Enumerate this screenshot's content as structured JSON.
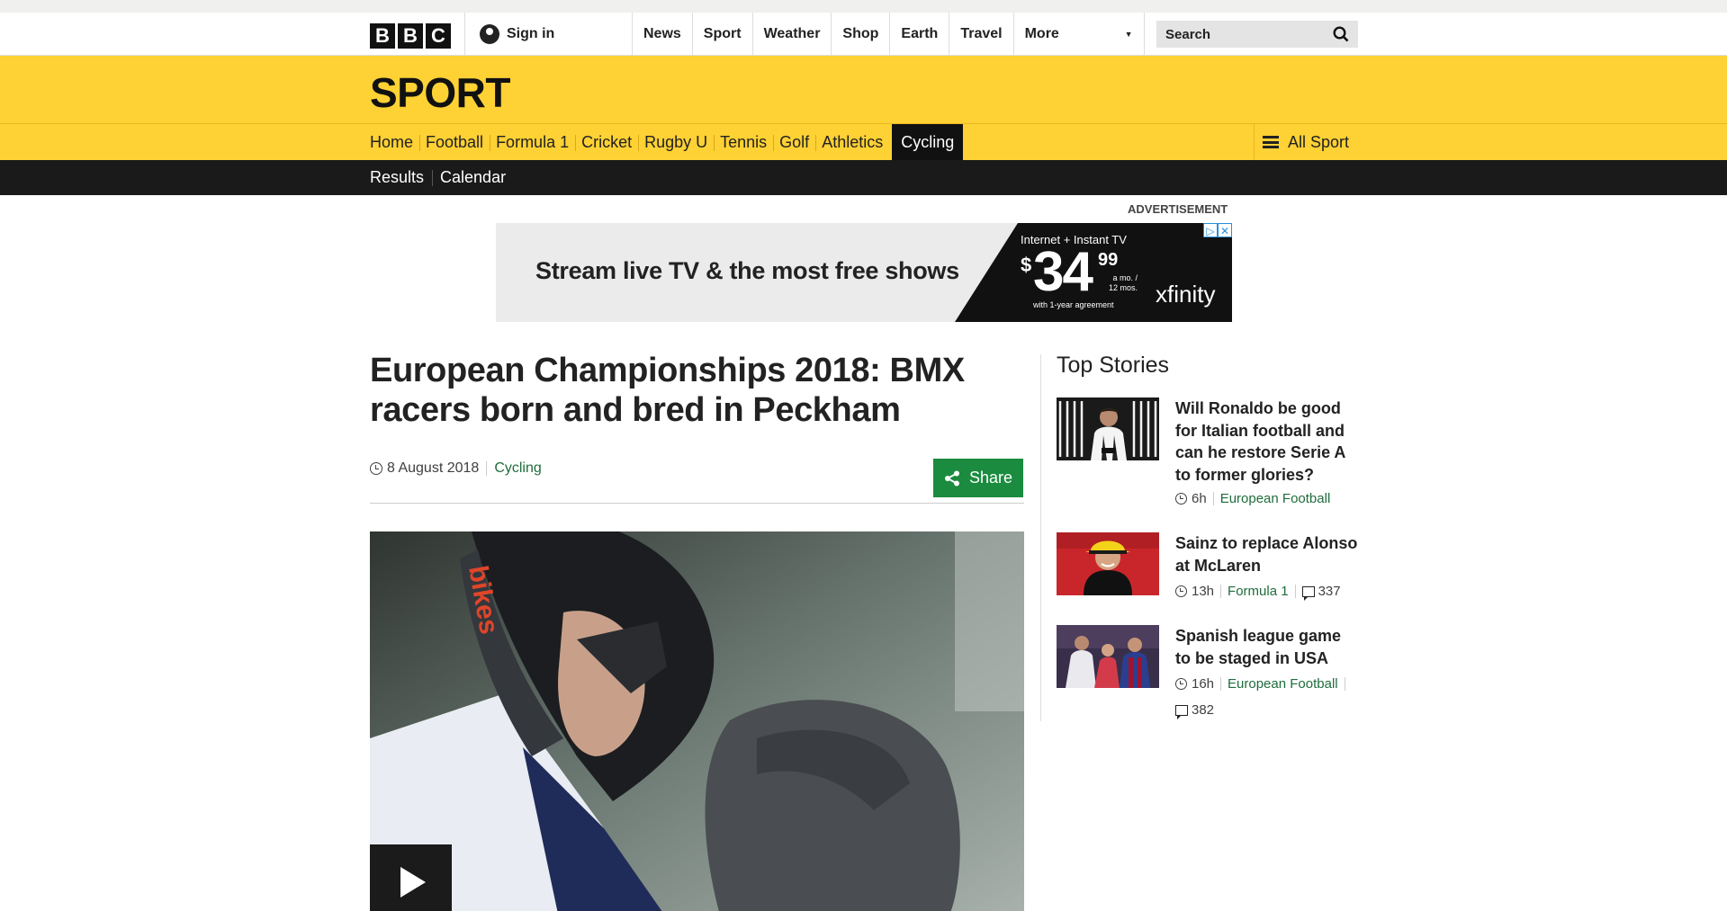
{
  "bbc": {
    "logo_letters": [
      "B",
      "B",
      "C"
    ],
    "signin_label": "Sign in",
    "nav": [
      "News",
      "Sport",
      "Weather",
      "Shop",
      "Earth",
      "Travel"
    ],
    "more_label": "More",
    "search_placeholder": "Search"
  },
  "sport": {
    "title": "SPORT",
    "nav": [
      "Home",
      "Football",
      "Formula 1",
      "Cricket",
      "Rugby U",
      "Tennis",
      "Golf",
      "Athletics",
      "Cycling"
    ],
    "active": "Cycling",
    "all_sport_label": "All Sport",
    "subnav": [
      "Results",
      "Calendar"
    ]
  },
  "ad": {
    "label": "ADVERTISEMENT",
    "tagline": "Stream live TV & the most free shows",
    "offer_line": "Internet + Instant TV",
    "dollar": "$",
    "price": "34",
    "cents": "99",
    "period": "a mo. / 12 mos.",
    "agreement": "with 1-year agreement",
    "brand": "xfinity"
  },
  "article": {
    "headline": "European Championships 2018: BMX racers born and bred in Peckham",
    "date": "8 August 2018",
    "topic": "Cycling",
    "share_label": "Share"
  },
  "top_stories": {
    "heading": "Top Stories",
    "items": [
      {
        "title": "Will Ronaldo be good for Italian football and can he restore Serie A to former glories?",
        "time": "6h",
        "topic": "European Football",
        "comments": ""
      },
      {
        "title": "Sainz to replace Alonso at McLaren",
        "time": "13h",
        "topic": "Formula 1",
        "comments": "337"
      },
      {
        "title": "Spanish league game to be staged in USA",
        "time": "16h",
        "topic": "European Football",
        "comments": "382"
      }
    ]
  },
  "colors": {
    "sport_yellow": "#fed134",
    "subnav_black": "#1a1a1a",
    "topic_green": "#1f6d3b",
    "share_green": "#1a8b3f"
  },
  "icons": [
    "user-icon",
    "caret-down-icon",
    "search-icon",
    "hamburger-icon",
    "clock-icon",
    "share-icon",
    "play-icon",
    "comment-icon",
    "adchoices-icon",
    "close-icon"
  ]
}
